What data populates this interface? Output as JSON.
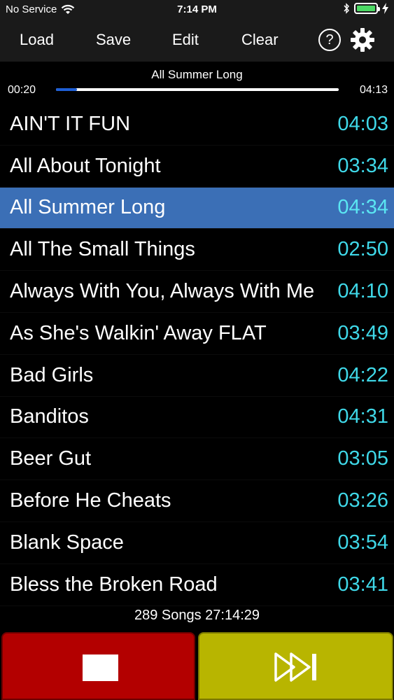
{
  "status_bar": {
    "carrier": "No Service",
    "time": "7:14 PM"
  },
  "toolbar": {
    "load_label": "Load",
    "save_label": "Save",
    "edit_label": "Edit",
    "clear_label": "Clear",
    "help_label": "?"
  },
  "now_playing": {
    "title": "All Summer Long",
    "elapsed": "00:20",
    "total": "04:13",
    "progress": 0.074
  },
  "songs": [
    {
      "title": "AIN'T IT FUN",
      "duration": "04:03",
      "selected": false
    },
    {
      "title": "All About Tonight",
      "duration": "03:34",
      "selected": false
    },
    {
      "title": "All Summer Long",
      "duration": "04:34",
      "selected": true
    },
    {
      "title": "All The Small Things",
      "duration": "02:50",
      "selected": false
    },
    {
      "title": "Always With You, Always With Me",
      "duration": "04:10",
      "selected": false
    },
    {
      "title": "As She's Walkin' Away FLAT",
      "duration": "03:49",
      "selected": false
    },
    {
      "title": "Bad Girls",
      "duration": "04:22",
      "selected": false
    },
    {
      "title": "Banditos",
      "duration": "04:31",
      "selected": false
    },
    {
      "title": "Beer Gut",
      "duration": "03:05",
      "selected": false
    },
    {
      "title": "Before He Cheats",
      "duration": "03:26",
      "selected": false
    },
    {
      "title": "Blank Space",
      "duration": "03:54",
      "selected": false
    },
    {
      "title": "Bless the Broken Road",
      "duration": "03:41",
      "selected": false
    }
  ],
  "summary": "289 Songs 27:14:29",
  "colors": {
    "accent_duration": "#3fd8e8",
    "selected_row": "#3b6fb6",
    "stop_button": "#b30000",
    "next_button": "#b8b500",
    "progress": "#1e5fd6"
  }
}
